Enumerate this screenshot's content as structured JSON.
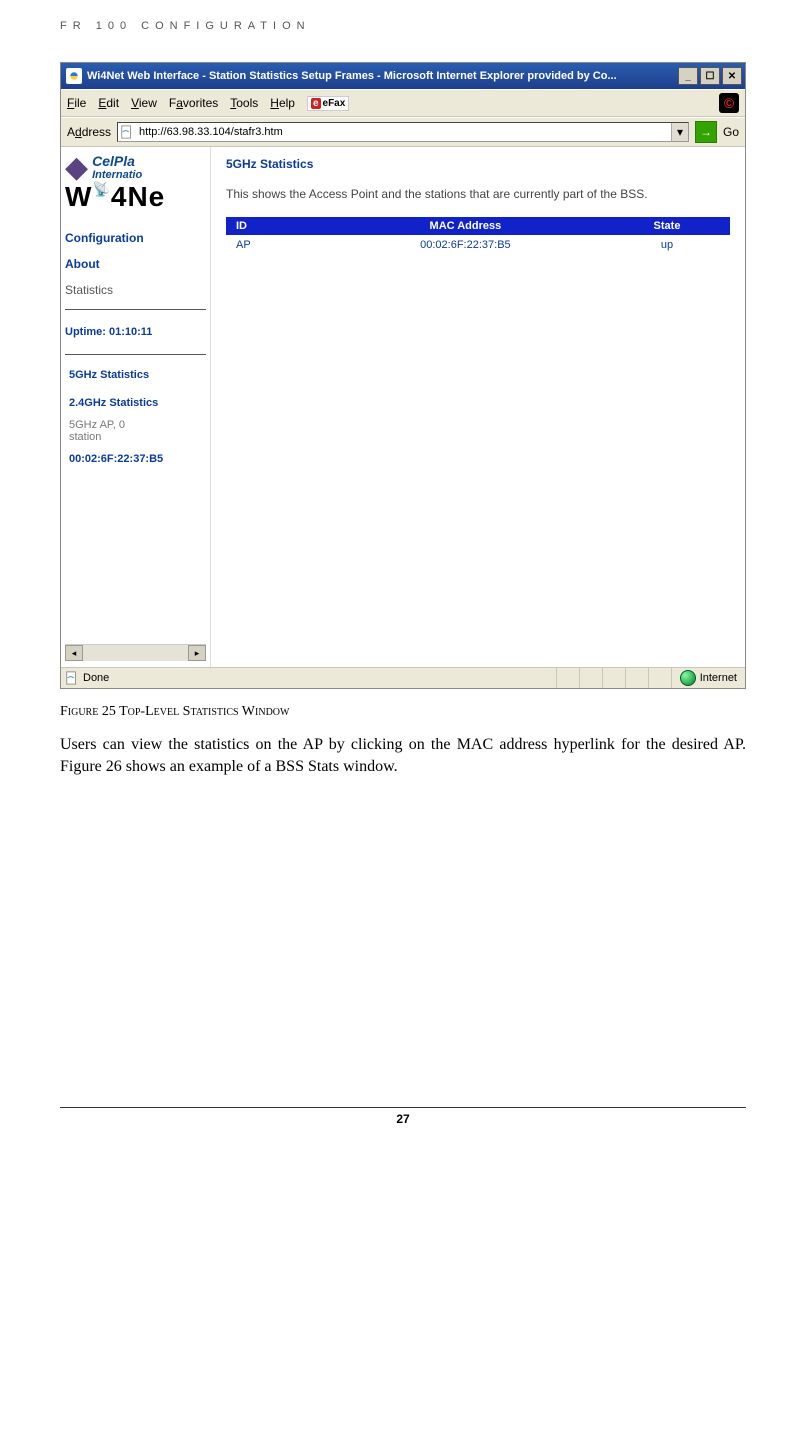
{
  "page": {
    "header": "FR 100 CONFIGURATION",
    "footer_page_number": "27",
    "figure_caption": "Figure 25 Top-Level Statistics Window",
    "body_text": "Users can view the statistics on the AP by clicking on the MAC address hyperlink for the desired AP. Figure 26 shows an example of a BSS Stats window."
  },
  "browser": {
    "title": "Wi4Net Web Interface - Station Statistics Setup Frames - Microsoft Internet Explorer provided by Co...",
    "menu": {
      "file": "File",
      "edit": "Edit",
      "view": "View",
      "favorites": "Favorites",
      "tools": "Tools",
      "help": "Help",
      "efax": "eFax"
    },
    "address_label": "Address",
    "address_value": "http://63.98.33.104/stafr3.htm",
    "go_label": "Go",
    "status_left": "Done",
    "status_zone": "Internet"
  },
  "sidebar": {
    "brand1": "CelPla",
    "brand1_sub": "Internatio",
    "brand2": "W i 4 N e",
    "nav": {
      "config": "Configuration",
      "about": "About",
      "stats": "Statistics"
    },
    "uptime": "Uptime: 01:10:11",
    "links": {
      "l1": "5GHz Statistics",
      "l2": "2.4GHz Statistics",
      "l3a": "5GHz AP, 0",
      "l3b": "station",
      "l4": "00:02:6F:22:37:B5"
    }
  },
  "stats": {
    "title": "5GHz Statistics",
    "desc": "This shows the Access Point and the stations that are currently part of the BSS.",
    "cols": {
      "id": "ID",
      "mac": "MAC Address",
      "state": "State"
    },
    "rows": [
      {
        "id": "AP",
        "mac": "00:02:6F:22:37:B5",
        "state": "up"
      }
    ]
  }
}
